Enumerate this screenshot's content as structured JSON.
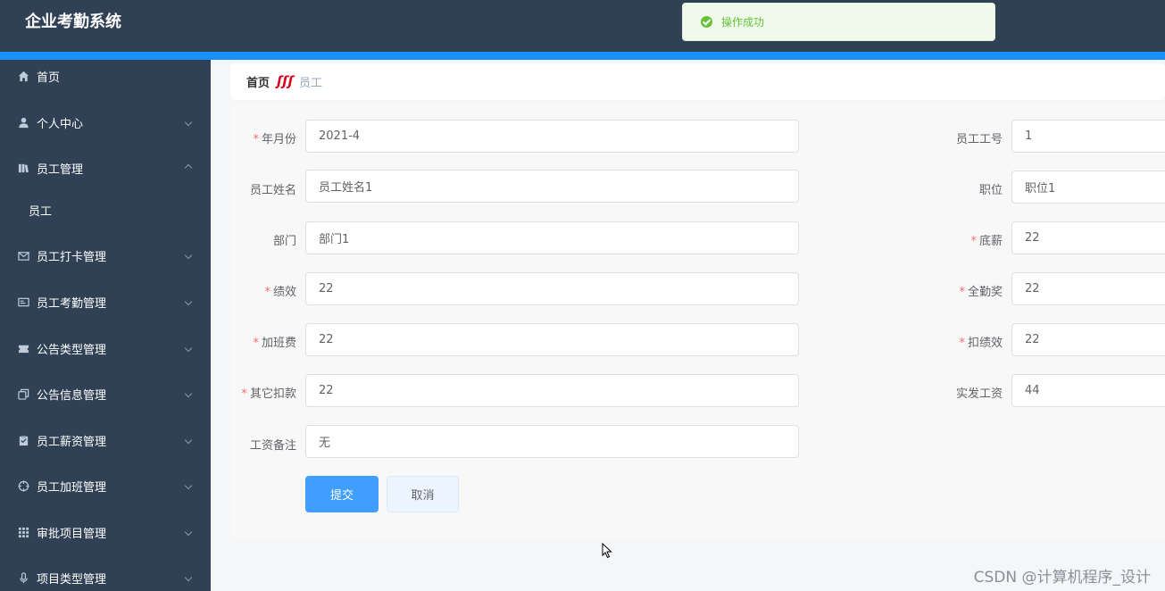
{
  "app": {
    "title": "企业考勤系统"
  },
  "toast": {
    "message": "操作成功"
  },
  "sidebar": {
    "items": [
      {
        "label": "首页",
        "icon": "home-icon"
      },
      {
        "label": "个人中心",
        "icon": "user-icon"
      },
      {
        "label": "员工管理",
        "icon": "books-icon"
      },
      {
        "label": "员工",
        "icon": ""
      },
      {
        "label": "员工打卡管理",
        "icon": "mail-icon"
      },
      {
        "label": "员工考勤管理",
        "icon": "card-icon"
      },
      {
        "label": "公告类型管理",
        "icon": "ticket-icon"
      },
      {
        "label": "公告信息管理",
        "icon": "copy-icon"
      },
      {
        "label": "员工薪资管理",
        "icon": "clipboard-icon"
      },
      {
        "label": "员工加班管理",
        "icon": "target-icon"
      },
      {
        "label": "审批项目管理",
        "icon": "grid-icon"
      },
      {
        "label": "项目类型管理",
        "icon": "mic-icon"
      }
    ]
  },
  "breadcrumb": {
    "home": "首页",
    "separator": "ʃʃʃ",
    "current": "员工"
  },
  "form": {
    "year_month": {
      "label": "年月份",
      "value": "2021-4"
    },
    "employee_no": {
      "label": "员工工号",
      "value": "1"
    },
    "employee_name": {
      "label": "员工姓名",
      "value": "员工姓名1"
    },
    "position": {
      "label": "职位",
      "value": "职位1"
    },
    "department": {
      "label": "部门",
      "value": "部门1"
    },
    "base_salary": {
      "label": "底薪",
      "value": "22"
    },
    "performance": {
      "label": "绩效",
      "value": "22"
    },
    "attendance_bonus": {
      "label": "全勤奖",
      "value": "22"
    },
    "overtime_pay": {
      "label": "加班费",
      "value": "22"
    },
    "performance_deduction": {
      "label": "扣绩效",
      "value": "22"
    },
    "other_deduction": {
      "label": "其它扣款",
      "value": "22"
    },
    "actual_salary": {
      "label": "实发工资",
      "value": "44"
    },
    "salary_note": {
      "label": "工资备注",
      "value": "无"
    },
    "required_mark": "*",
    "submit_label": "提交",
    "cancel_label": "取消"
  },
  "watermark": "CSDN @计算机程序_设计",
  "colors": {
    "sidebar": "#304156",
    "accent": "#1890ff",
    "primary_button": "#409eff",
    "success": "#67c23a",
    "required": "#f56c6c"
  }
}
